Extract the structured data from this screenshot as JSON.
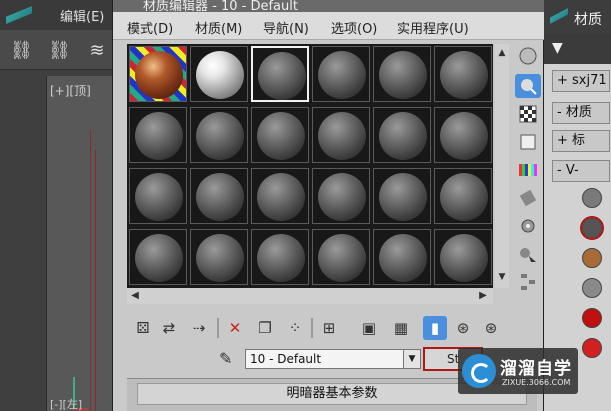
{
  "background_app": {
    "menu_edit": "编辑(E)",
    "viewport_label": "[+][顶]",
    "bottom_label": "[-][左]"
  },
  "editor": {
    "title_partial": "材质编辑器 - 10 - Default",
    "menu": [
      "模式(D)",
      "材质(M)",
      "导航(N)",
      "选项(O)",
      "实用程序(U)"
    ],
    "slots": {
      "rows": 4,
      "cols": 6,
      "selected_index": 2,
      "textured_index": 0,
      "white_index": 1
    },
    "material_name": "10 - Default",
    "type_button_label": "St",
    "rollout_title": "明暗器基本参数",
    "toolbar_icons": [
      "get-material-icon",
      "put-to-scene-icon",
      "assign-to-selection-icon",
      "reset-map-icon",
      "make-copy-icon",
      "make-unique-icon",
      "put-to-library-icon",
      "material-id-icon",
      "show-map-in-viewport-icon",
      "show-end-result-icon",
      "go-to-parent-icon",
      "go-forward-sibling-icon"
    ],
    "side_icons": [
      "sample-type-icon",
      "backlight-icon",
      "background-icon",
      "sample-uv-tiling-icon",
      "video-color-check-icon",
      "make-preview-icon",
      "options-icon",
      "select-by-material-icon",
      "material-map-navigator-icon"
    ]
  },
  "right_panel": {
    "title": "材质",
    "row_1": "+ sxj71",
    "row_2": "- 材质",
    "row_3": "+ 标",
    "row_4": "- V-",
    "swatch_colors": [
      "#7a7a7a",
      "#555555",
      "#a86a36",
      "#8a8a8a",
      "#c01010",
      "#d02020"
    ]
  },
  "watermark": {
    "title": "溜溜自学",
    "url": "ZIXUE.3066.COM"
  },
  "colors": {
    "accent_blue": "#4a8ede",
    "highlight_red": "#b01818"
  }
}
